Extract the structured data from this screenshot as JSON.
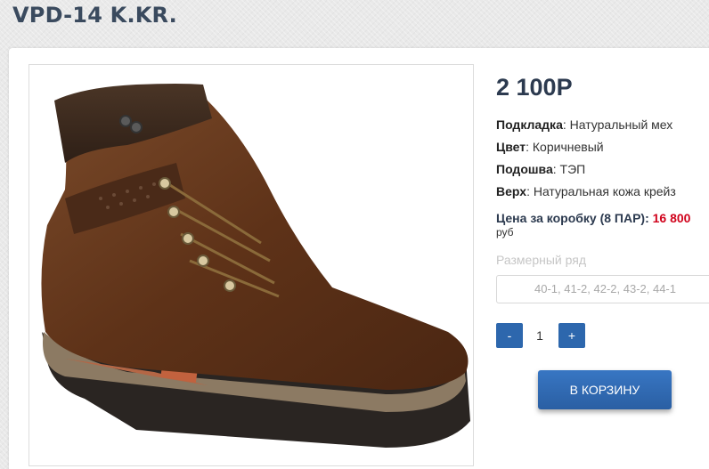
{
  "product": {
    "title": "VPD-14 K.KR.",
    "price": "2 100Р"
  },
  "specs": [
    {
      "label": "Подкладка",
      "value": "Натуральный мех"
    },
    {
      "label": "Цвет",
      "value": "Коричневый"
    },
    {
      "label": "Подошва",
      "value": "ТЭП"
    },
    {
      "label": "Верх",
      "value": "Натуральная кожа крейз"
    }
  ],
  "box_price": {
    "label": "Цена за коробку (8 ПАР):",
    "value": "16 800",
    "unit": "руб"
  },
  "sizes": {
    "label": "Размерный ряд",
    "selected": "40-1, 41-2, 42-2, 43-2, 44-1"
  },
  "quantity": {
    "minus": "-",
    "value": "1",
    "plus": "+"
  },
  "cart_button": "В корзину",
  "colors": {
    "price_accent": "#d0021b",
    "button_blue": "#2d67ad",
    "title": "#3a4a5e"
  },
  "icons": {
    "product_image": "brown-winter-boot"
  }
}
